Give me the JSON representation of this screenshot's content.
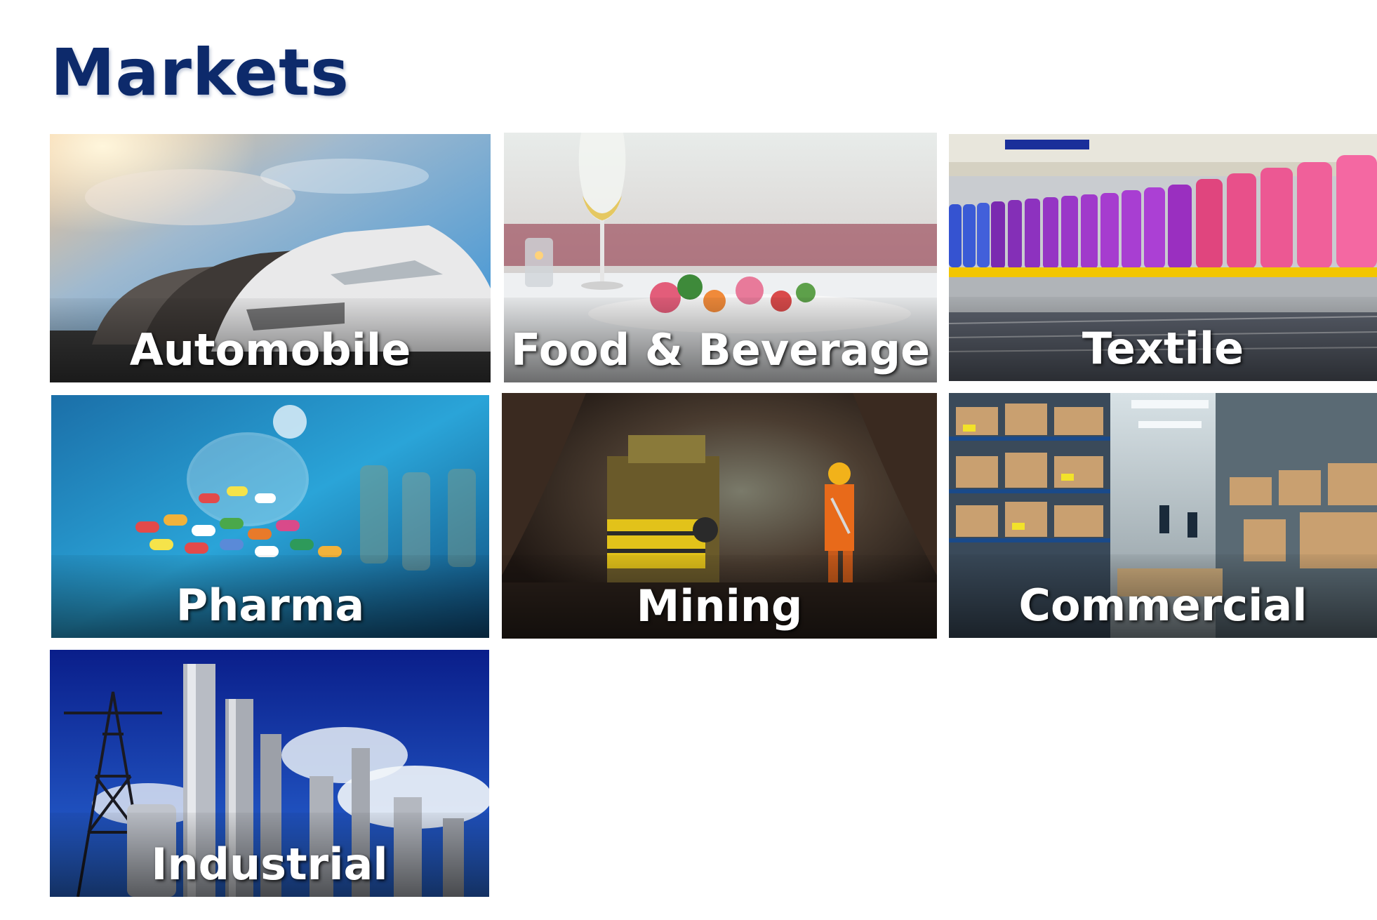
{
  "page": {
    "title": "Markets"
  },
  "tiles": [
    {
      "label": "Automobile",
      "icon": "car-lineup-image"
    },
    {
      "label": "Food & Beverage",
      "icon": "restaurant-table-image"
    },
    {
      "label": "Textile",
      "icon": "yarn-spools-image"
    },
    {
      "label": "Pharma",
      "icon": "pills-jar-image"
    },
    {
      "label": "Mining",
      "icon": "mine-tunnel-image"
    },
    {
      "label": "Commercial",
      "icon": "warehouse-shelves-image"
    },
    {
      "label": "Industrial",
      "icon": "refinery-towers-image"
    }
  ],
  "colors": {
    "title": "#0d2a6b",
    "label": "#ffffff"
  }
}
